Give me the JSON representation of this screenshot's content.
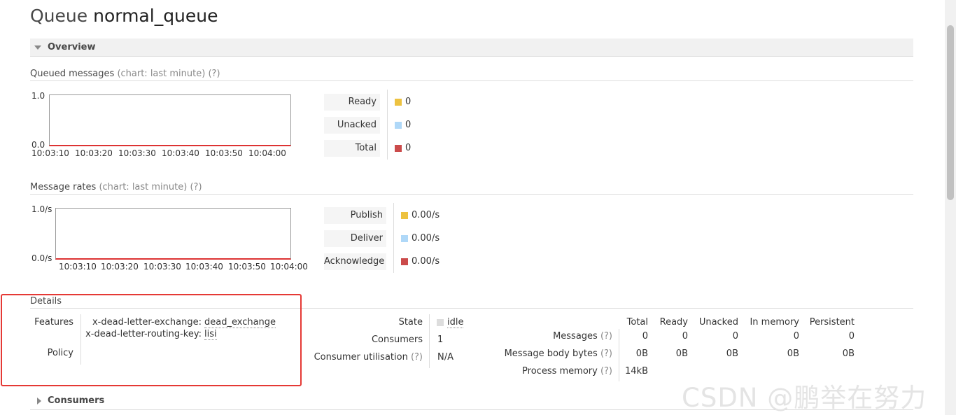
{
  "page": {
    "title_prefix": "Queue",
    "queue_name": "normal_queue"
  },
  "overview": {
    "header": "Overview",
    "queued_chart": {
      "title": "Queued messages",
      "hint": "(chart: last minute)",
      "help": "(?)",
      "y_top": "1.0",
      "y_bottom": "0.0",
      "x_ticks": [
        "10:03:10",
        "10:03:20",
        "10:03:30",
        "10:03:40",
        "10:03:50",
        "10:04:00"
      ],
      "legend": [
        {
          "label": "Ready",
          "value": "0",
          "color": "#edc240"
        },
        {
          "label": "Unacked",
          "value": "0",
          "color": "#afd8f8"
        },
        {
          "label": "Total",
          "value": "0",
          "color": "#cb4b4b"
        }
      ]
    },
    "rates_chart": {
      "title": "Message rates",
      "hint": "(chart: last minute)",
      "help": "(?)",
      "y_top": "1.0/s",
      "y_bottom": "0.0/s",
      "x_ticks": [
        "10:03:10",
        "10:03:20",
        "10:03:30",
        "10:03:40",
        "10:03:50",
        "10:04:00"
      ],
      "legend": [
        {
          "label": "Publish",
          "value": "0.00/s",
          "color": "#edc240"
        },
        {
          "label": "Deliver",
          "value": "0.00/s",
          "color": "#afd8f8"
        },
        {
          "label": "Acknowledge",
          "value": "0.00/s",
          "color": "#cb4b4b"
        }
      ]
    }
  },
  "details": {
    "header": "Details",
    "features_label": "Features",
    "features": [
      {
        "key": "x-dead-letter-exchange:",
        "value": "dead_exchange"
      },
      {
        "key": "x-dead-letter-routing-key:",
        "value": "lisi"
      }
    ],
    "policy_label": "Policy",
    "state_label": "State",
    "state_value": "idle",
    "consumers_label": "Consumers",
    "consumers_value": "1",
    "utilisation_label": "Consumer utilisation",
    "utilisation_help": "(?)",
    "utilisation_value": "N/A",
    "stats": {
      "columns": [
        "Total",
        "Ready",
        "Unacked",
        "In memory",
        "Persistent"
      ],
      "messages_label": "Messages",
      "messages_help": "(?)",
      "messages": [
        "0",
        "0",
        "0",
        "0",
        "0"
      ],
      "body_label": "Message body bytes",
      "body_help": "(?)",
      "body": [
        "0B",
        "0B",
        "0B",
        "0B",
        "0B"
      ],
      "memory_label": "Process memory",
      "memory_help": "(?)",
      "memory": "14kB"
    }
  },
  "consumers": {
    "header": "Consumers"
  },
  "watermark": "CSDN @鹏举在努力"
}
